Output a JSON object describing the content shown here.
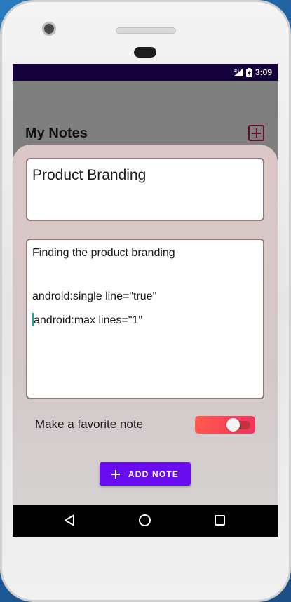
{
  "status_bar": {
    "network_label": "4G",
    "time": "3:09"
  },
  "app": {
    "title": "My Notes",
    "add_icon": "plus-square-icon"
  },
  "note_form": {
    "title_value": "Product Branding",
    "body_lines": [
      "Finding the product branding",
      "android:single line=\"true\"",
      "android:max lines=\"1\""
    ],
    "favorite_label": "Make a favorite note",
    "favorite_on": true,
    "add_button_label": "ADD NOTE"
  },
  "colors": {
    "status_bar": "#14003a",
    "accent": "#6a0cf0",
    "toggle": "#f0345e",
    "sheet": "#dcc7c7"
  },
  "nav_bar": {
    "icons": [
      "back-icon",
      "home-icon",
      "recent-apps-icon"
    ]
  }
}
